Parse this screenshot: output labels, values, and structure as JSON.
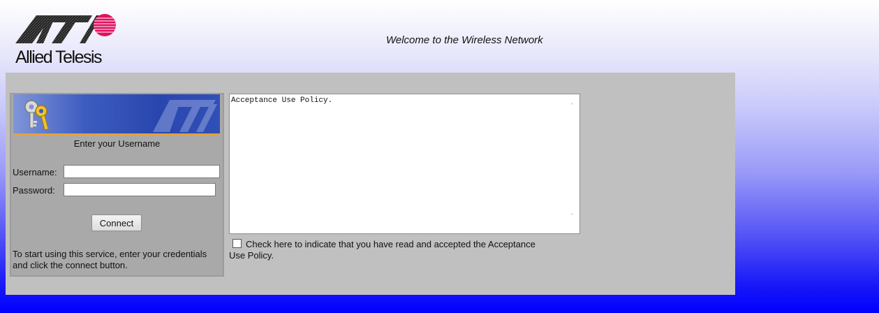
{
  "brand": {
    "logo_text": "Allied Telesis",
    "accent_color": "#e0115f"
  },
  "header": {
    "welcome": "Welcome to the Wireless Network"
  },
  "login": {
    "heading": "Enter your Username",
    "username_label": "Username:",
    "username_value": "",
    "password_label": "Password:",
    "password_value": "",
    "connect_label": "Connect",
    "instructions": "To start using this service, enter your credentials and click the connect button."
  },
  "aup": {
    "text": "Acceptance Use Policy.",
    "accept_label": "Check here to indicate that you have read and accepted the Acceptance Use Policy.",
    "accepted": false
  },
  "icons": {
    "banner": "keys-icon",
    "scroll_up": "chevron-up-icon",
    "scroll_down": "chevron-down-icon"
  }
}
